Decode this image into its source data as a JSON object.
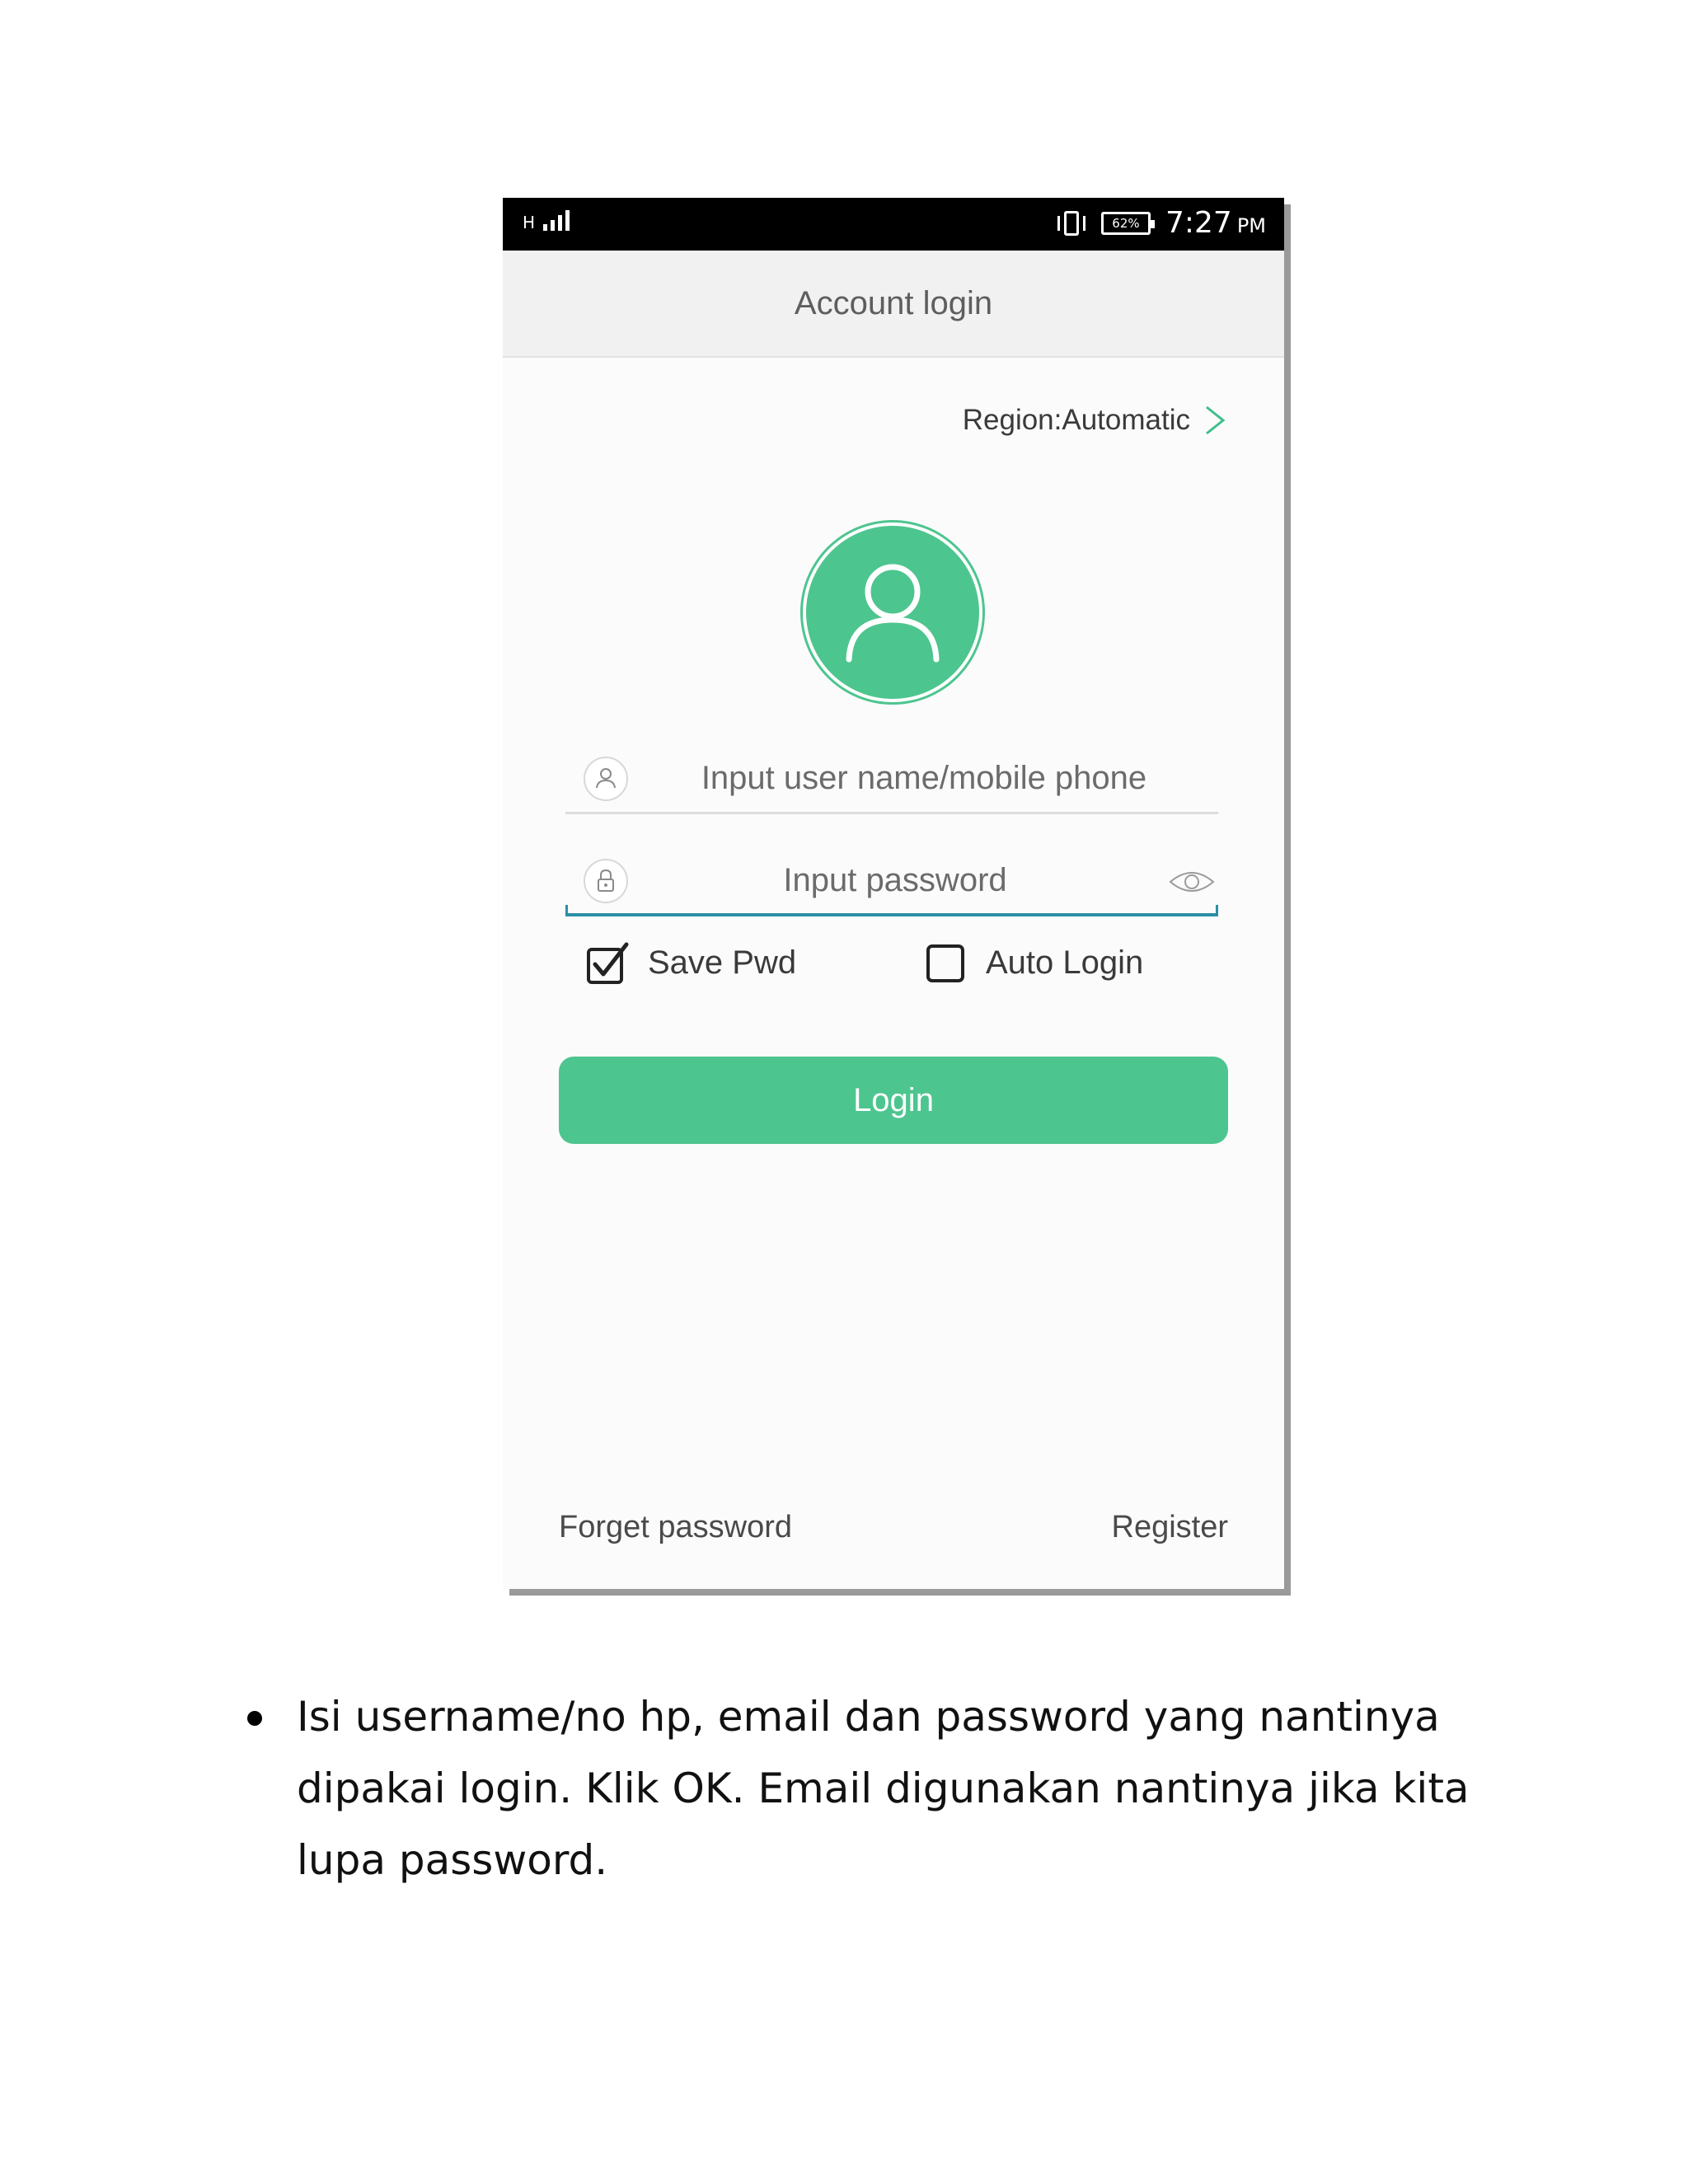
{
  "status_bar": {
    "network": "H",
    "battery": "62%",
    "time": "7:27",
    "ampm": "PM",
    "icons": [
      "signal-icon",
      "vibrate-icon",
      "battery-icon"
    ]
  },
  "header": {
    "title": "Account login"
  },
  "region": {
    "label": "Region:Automatic",
    "icon": "chevron-right-icon"
  },
  "form": {
    "username": {
      "placeholder": "Input user name/mobile phone",
      "value": "",
      "icon": "user-icon"
    },
    "password": {
      "placeholder": "Input password",
      "value": "",
      "icon": "lock-icon",
      "toggle_icon": "eye-icon"
    },
    "save_pwd": {
      "label": "Save Pwd",
      "checked": true
    },
    "auto_login": {
      "label": "Auto Login",
      "checked": false
    },
    "login_label": "Login"
  },
  "footer": {
    "forget_password": "Forget password",
    "register": "Register"
  },
  "instruction": {
    "lines": [
      "Isi username/no hp, email dan password yang nantinya",
      "dipakai login. Klik OK.  Email digunakan nantinya jika kita",
      "lupa password."
    ]
  },
  "colors": {
    "accent": "#4dc58f",
    "focus_underline": "#2b8fa6",
    "status_bar": "#000000",
    "header_bg": "#f1f1f1"
  }
}
